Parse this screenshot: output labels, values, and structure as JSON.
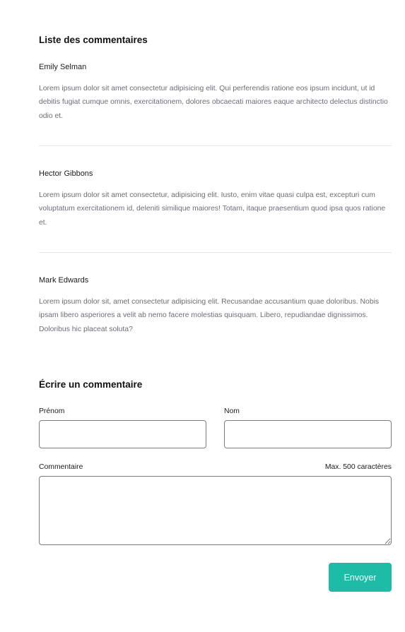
{
  "comments_section": {
    "title": "Liste des commentaires",
    "comments": [
      {
        "author": "Emily Selman",
        "text": "Lorem ipsum dolor sit amet consectetur adipisicing elit. Qui perferendis ratione eos ipsum incidunt, ut id debitis fugiat cumque omnis, exercitationem, dolores obcaecati maiores eaque architecto delectus distinctio odio et."
      },
      {
        "author": "Hector Gibbons",
        "text": "Lorem ipsum dolor sit amet consectetur, adipisicing elit. Iusto, enim vitae quasi culpa est, excepturi cum voluptatum exercitationem id, deleniti similique maiores! Totam, itaque praesentium quod ipsa quos ratione et."
      },
      {
        "author": "Mark Edwards",
        "text": "Lorem ipsum dolor sit, amet consectetur adipisicing elit. Recusandae accusantium quae doloribus. Nobis ipsam libero asperiores a velit ab nemo facere molestias quisquam. Libero, repudiandae dignissimos. Doloribus hic placeat soluta?"
      }
    ]
  },
  "form": {
    "title": "Écrire un commentaire",
    "first_name_label": "Prénom",
    "first_name_value": "",
    "last_name_label": "Nom",
    "last_name_value": "",
    "comment_label": "Commentaire",
    "comment_limit": "Max. 500 caractères",
    "comment_value": "",
    "submit_label": "Envoyer"
  },
  "colors": {
    "accent": "#1ebca7",
    "body_text": "#6d6d78",
    "divider": "#e6e6ea",
    "input_border": "#7b7b85"
  }
}
